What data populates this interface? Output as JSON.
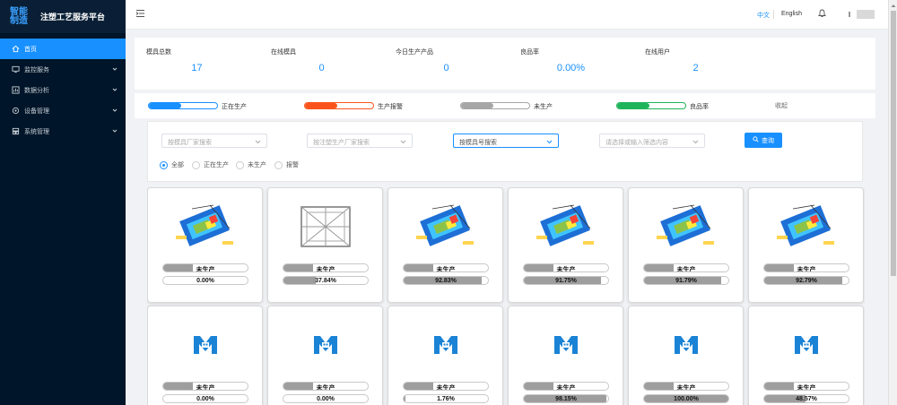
{
  "app": {
    "logo_text_line1": "智能",
    "logo_text_line2": "制造",
    "title": "注塑工艺服务平台"
  },
  "sidebar": {
    "items": [
      {
        "label": "首页",
        "icon": "home-icon",
        "active": true
      },
      {
        "label": "监控服务",
        "icon": "monitor-icon",
        "active": false
      },
      {
        "label": "数据分析",
        "icon": "chart-icon",
        "active": false
      },
      {
        "label": "设备管理",
        "icon": "gear-icon",
        "active": false
      },
      {
        "label": "系统管理",
        "icon": "user-group-icon",
        "active": false
      }
    ]
  },
  "header": {
    "lang_zh": "中文",
    "lang_en": "English"
  },
  "stats": [
    {
      "label": "模具总数",
      "value": "17"
    },
    {
      "label": "在线模具",
      "value": "0"
    },
    {
      "label": "今日生产产品",
      "value": "0"
    },
    {
      "label": "良品率",
      "value": "0.00%"
    },
    {
      "label": "在线用户",
      "value": "2"
    }
  ],
  "legend": {
    "items": [
      {
        "label": "正在生产",
        "color": "#1890ff"
      },
      {
        "label": "生产报警",
        "color": "#fa541c"
      },
      {
        "label": "未生产",
        "color": "#a6a6a6"
      },
      {
        "label": "良品率",
        "color": "#1fb45a"
      }
    ],
    "collapse_label": "收起"
  },
  "filters": {
    "select1_placeholder": "按模具厂家搜索",
    "select2_placeholder": "按注塑生产厂家搜索",
    "select3_placeholder": "按模具号搜索",
    "select4_placeholder": "请选择或输入筛选内容",
    "query_label": "查询",
    "radios": [
      {
        "label": "全部",
        "checked": true
      },
      {
        "label": "正在生产",
        "checked": false
      },
      {
        "label": "未生产",
        "checked": false
      },
      {
        "label": "报警",
        "checked": false
      }
    ]
  },
  "cards": [
    {
      "image": "mold-render-thumbnail",
      "status": "未生产",
      "status_fill": 0.35,
      "yield": "0.00%",
      "yield_fill": 0.0
    },
    {
      "image": "mold-frame-thumbnail",
      "status": "未生产",
      "status_fill": 0.35,
      "yield": "37.84%",
      "yield_fill": 0.3784
    },
    {
      "image": "mold-render-thumbnail",
      "status": "未生产",
      "status_fill": 0.35,
      "yield": "92.83%",
      "yield_fill": 0.9283
    },
    {
      "image": "mold-render-thumbnail",
      "status": "未生产",
      "status_fill": 0.35,
      "yield": "91.75%",
      "yield_fill": 0.9175
    },
    {
      "image": "mold-render-thumbnail",
      "status": "未生产",
      "status_fill": 0.35,
      "yield": "91.79%",
      "yield_fill": 0.9179
    },
    {
      "image": "mold-render-thumbnail",
      "status": "未生产",
      "status_fill": 0.35,
      "yield": "92.79%",
      "yield_fill": 0.9279
    },
    {
      "image": "placeholder-logo-icon",
      "status": "未生产",
      "status_fill": 0.35,
      "yield": "0.00%",
      "yield_fill": 0.0
    },
    {
      "image": "placeholder-logo-icon",
      "status": "未生产",
      "status_fill": 0.35,
      "yield": "0.00%",
      "yield_fill": 0.0
    },
    {
      "image": "placeholder-logo-icon",
      "status": "未生产",
      "status_fill": 0.35,
      "yield": "1.76%",
      "yield_fill": 0.0176
    },
    {
      "image": "placeholder-logo-icon",
      "status": "未生产",
      "status_fill": 0.35,
      "yield": "98.15%",
      "yield_fill": 0.9815
    },
    {
      "image": "placeholder-logo-icon",
      "status": "未生产",
      "status_fill": 0.35,
      "yield": "100.00%",
      "yield_fill": 1.0
    },
    {
      "image": "placeholder-logo-icon",
      "status": "未生产",
      "status_fill": 0.35,
      "yield": "48.57%",
      "yield_fill": 0.4857
    }
  ]
}
